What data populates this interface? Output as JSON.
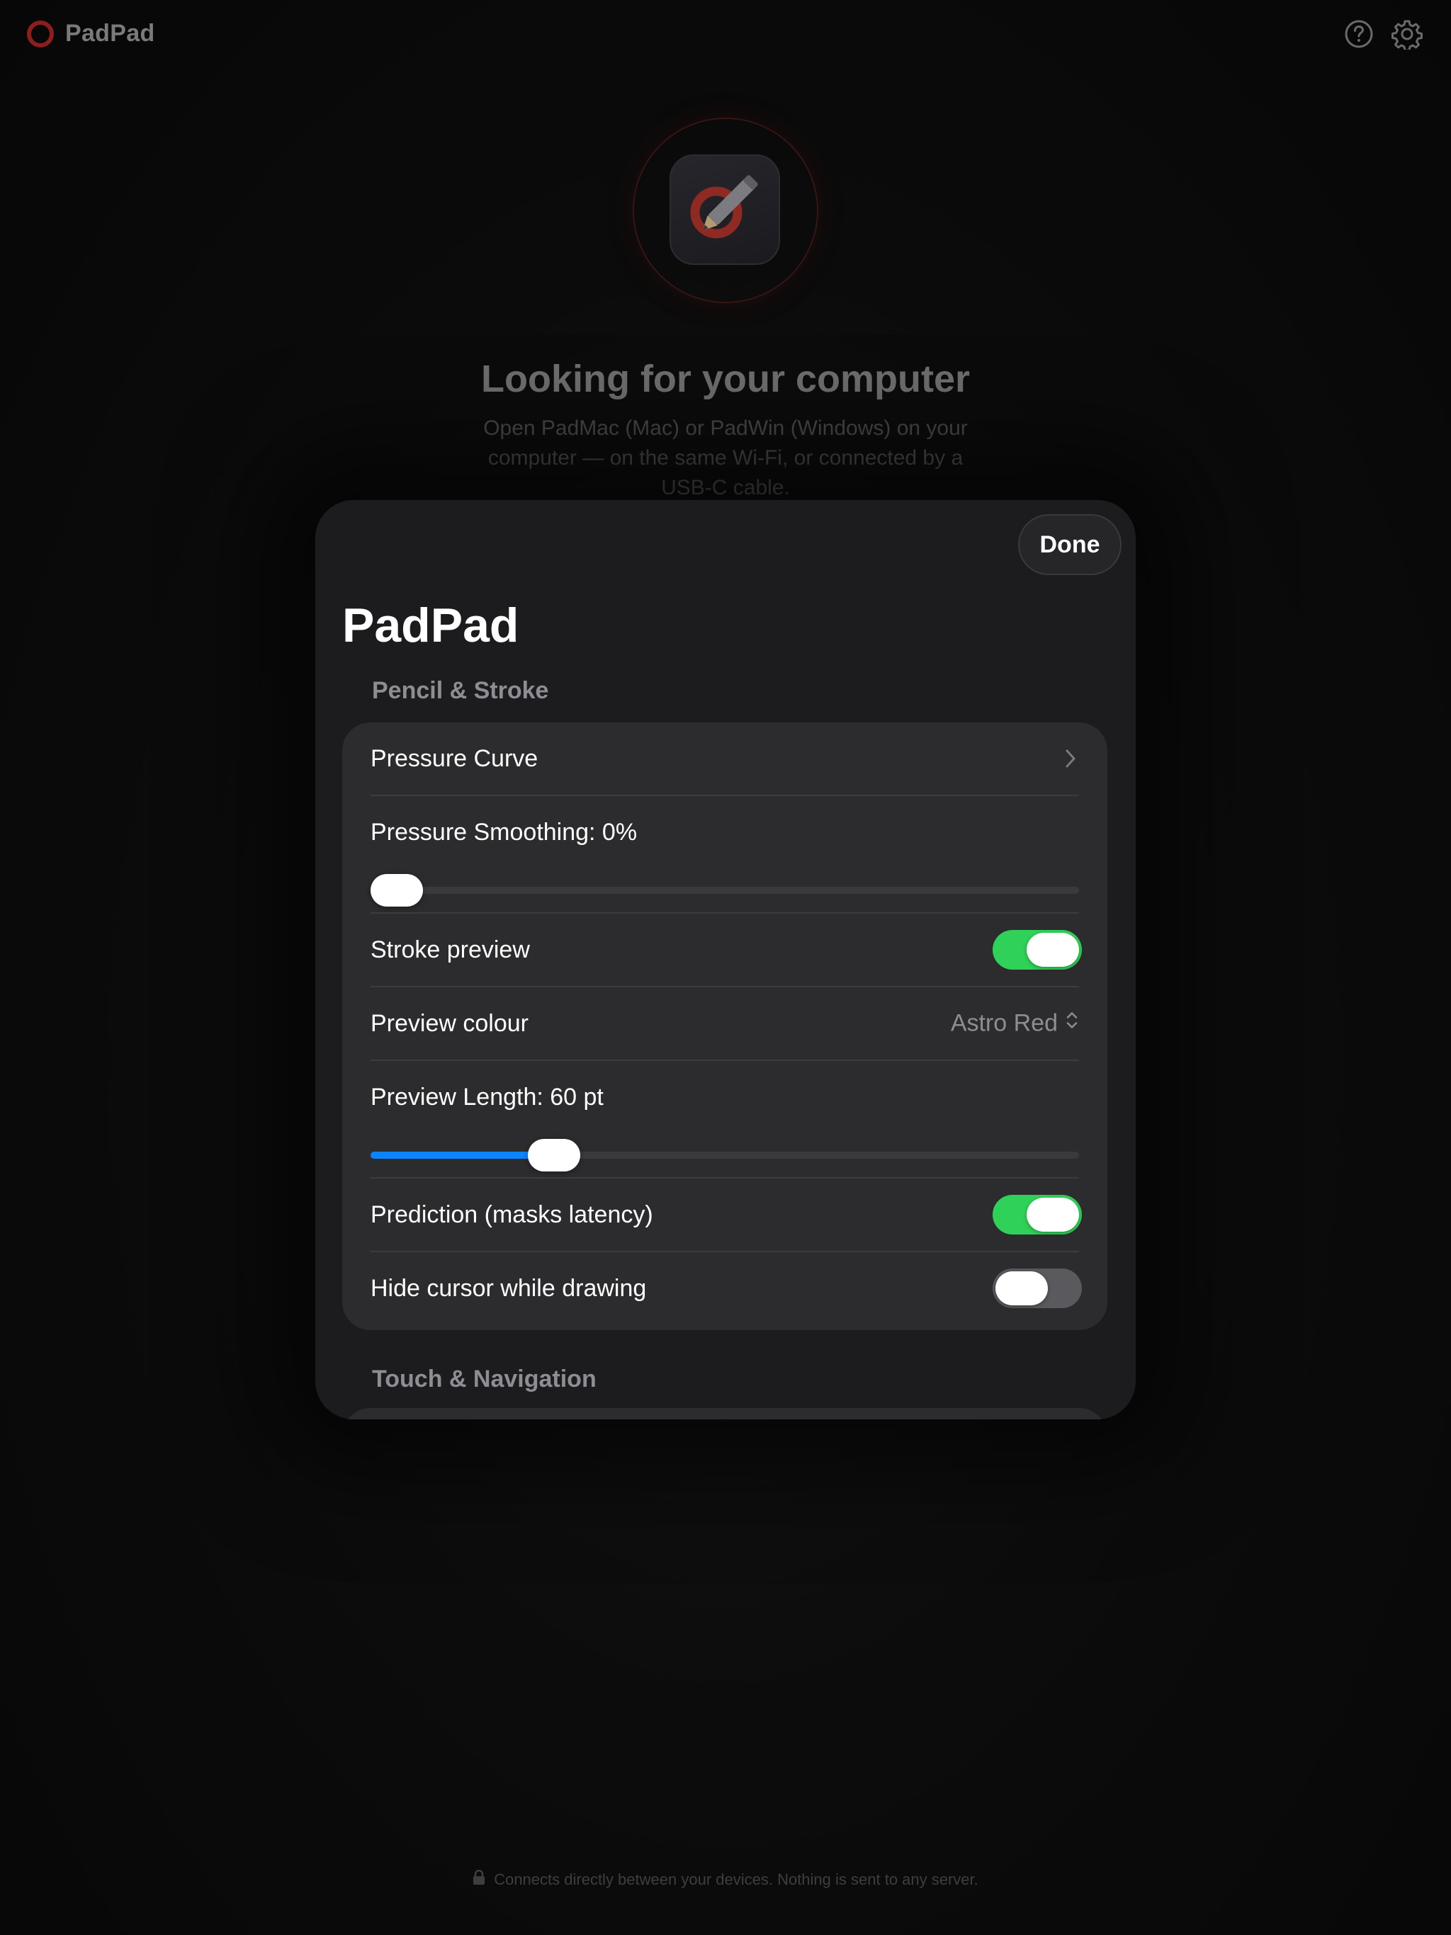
{
  "background": {
    "brand": {
      "name": "PadPad",
      "icon": "ring-logo-icon"
    },
    "top_icons": [
      "help-circle-icon",
      "gear-icon"
    ],
    "hero": {
      "icon": "pencil-ring-app-icon",
      "title": "Looking for your computer",
      "subtitle": "Open PadMac (Mac) or PadWin (Windows) on your computer — on the same Wi-Fi, or connected by a USB-C cable."
    },
    "footer": {
      "icon": "lock-icon",
      "text": "Connects directly between your devices. Nothing is sent to any server."
    }
  },
  "sheet": {
    "done_label": "Done",
    "title": "PadPad",
    "sections": {
      "pencil_stroke": {
        "header": "Pencil & Stroke",
        "pressure_curve": {
          "label": "Pressure Curve",
          "icon": "chevron-right-icon"
        },
        "pressure_smoothing": {
          "label": "Pressure Smoothing: 0%",
          "value_fraction": 0.0
        },
        "stroke_preview": {
          "label": "Stroke preview",
          "on": true
        },
        "preview_colour": {
          "label": "Preview colour",
          "value": "Astro Red",
          "icon": "up-down-chevron-icon"
        },
        "preview_length": {
          "label": "Preview Length: 60 pt",
          "value_fraction": 0.24
        },
        "prediction": {
          "label": "Prediction (masks latency)",
          "on": true
        },
        "hide_cursor": {
          "label": "Hide cursor while drawing",
          "on": false
        }
      },
      "touch_navigation": {
        "header": "Touch & Navigation"
      }
    }
  },
  "colors": {
    "accent_blue": "#0a84ff",
    "toggle_green": "#30d158",
    "brand_red": "#8e1e1e"
  }
}
